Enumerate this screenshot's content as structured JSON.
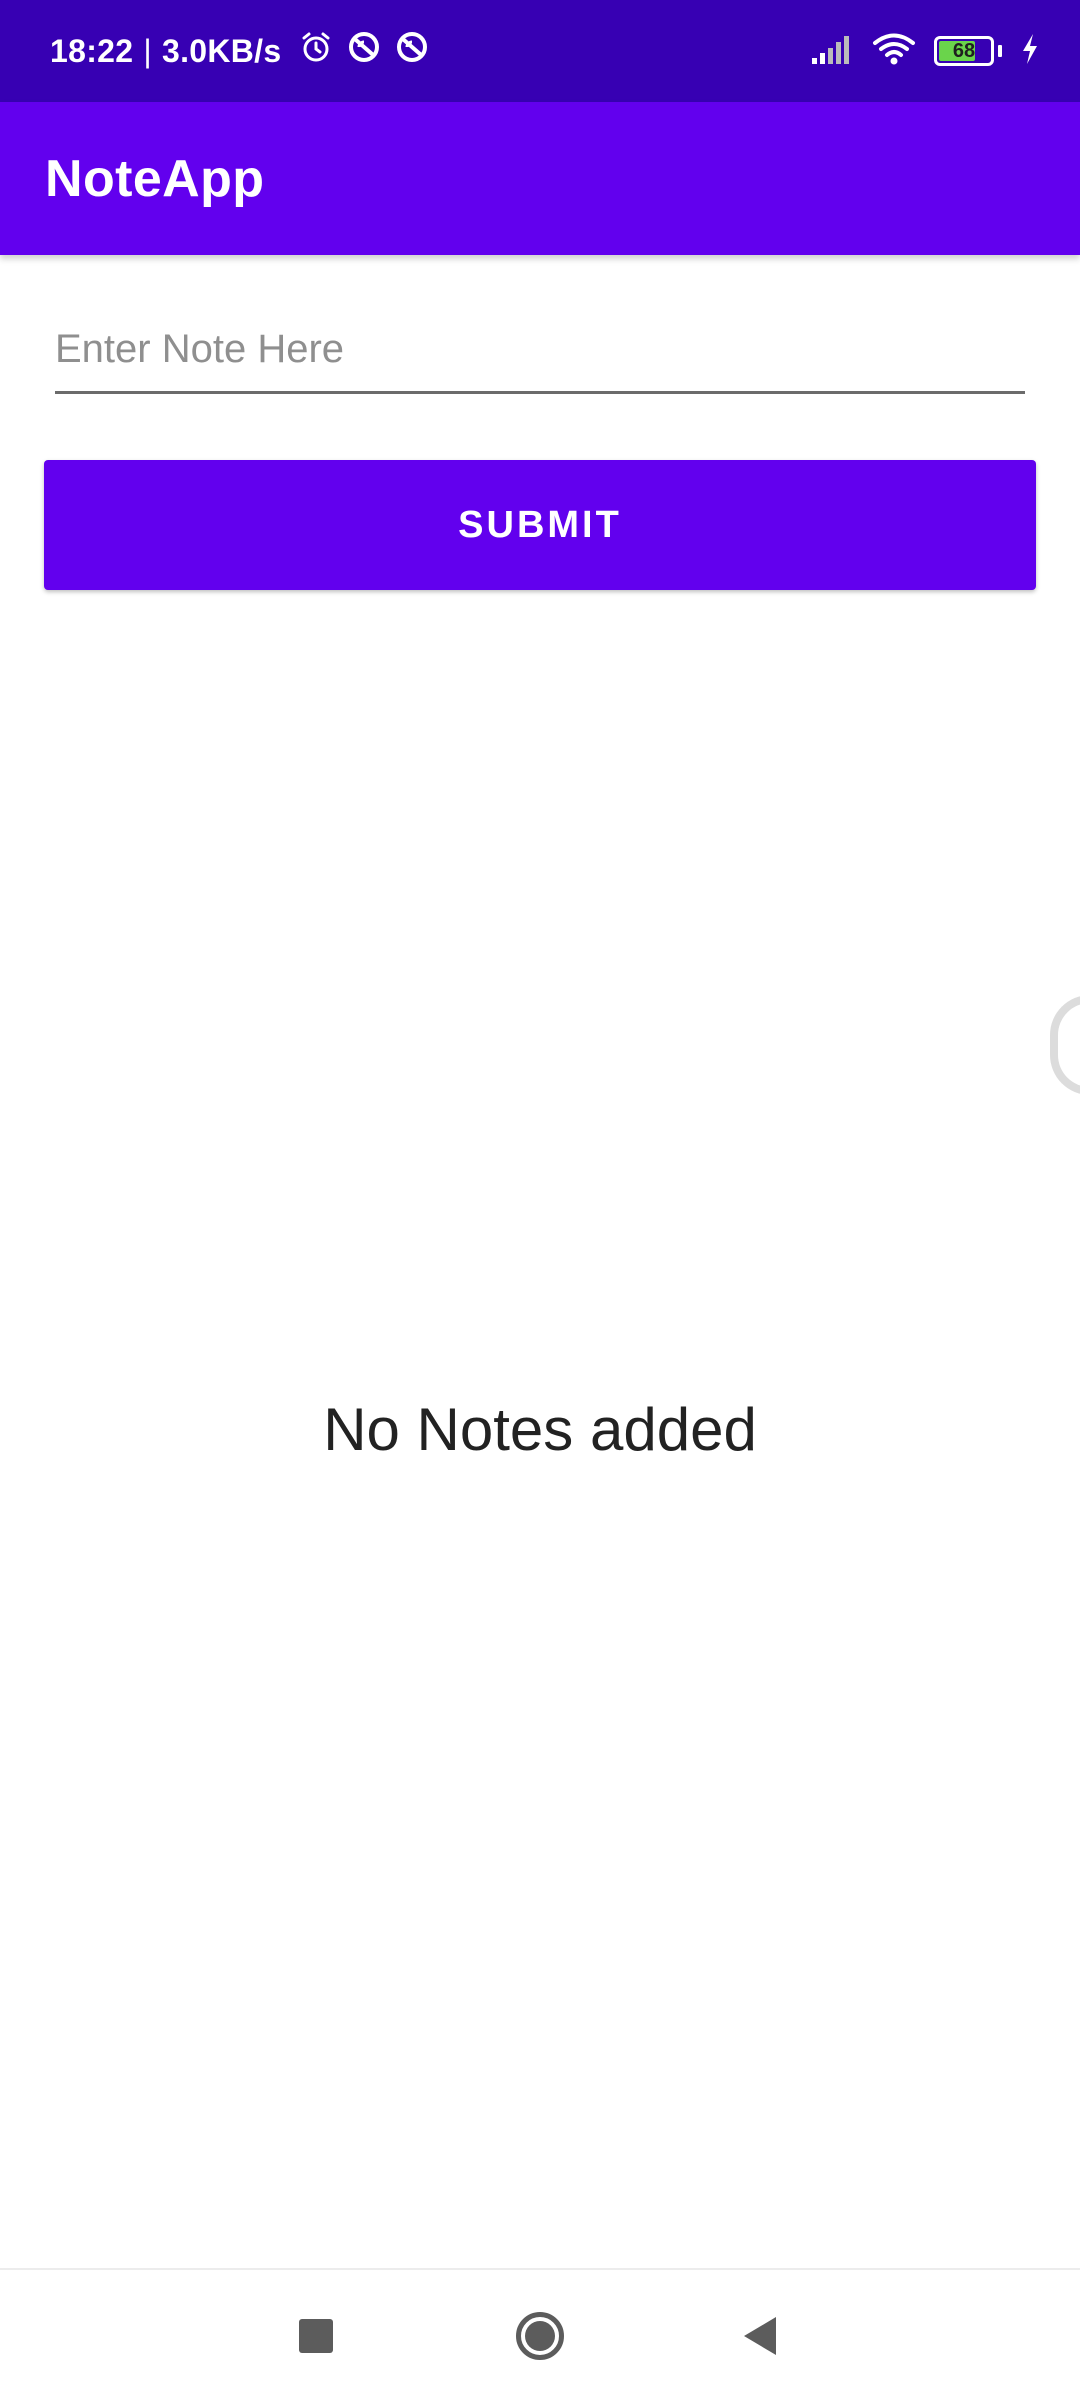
{
  "status_bar": {
    "time": "18:22",
    "separator": "|",
    "network_speed": "3.0KB/s",
    "left_icons": [
      "alarm-icon",
      "data-saver-icon",
      "data-saver-icon"
    ],
    "right_icons": [
      "signal-icon",
      "wifi-icon",
      "battery-icon",
      "charging-icon"
    ],
    "battery_level": "68",
    "background_color": "#3700B3"
  },
  "app_bar": {
    "title": "NoteApp",
    "background_color": "#6200EE"
  },
  "note_form": {
    "input_value": "",
    "input_placeholder": "Enter Note Here",
    "submit_label": "SUBMIT"
  },
  "notes_list": {
    "items": [],
    "empty_message": "No Notes added"
  },
  "nav_bar": {
    "buttons": [
      "recents-icon",
      "home-icon",
      "back-icon"
    ]
  }
}
